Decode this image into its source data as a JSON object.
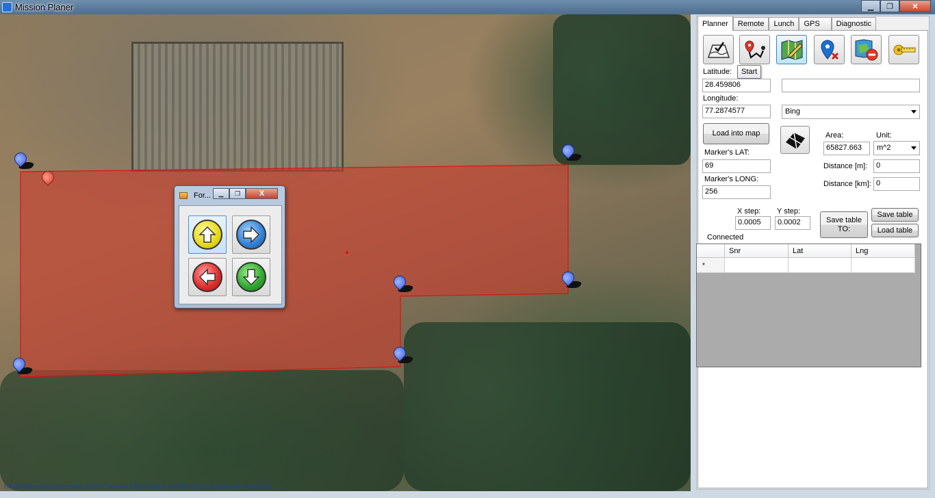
{
  "window": {
    "title": "Mission Planer",
    "controls": {
      "minimize": "▁",
      "maximize": "❐",
      "close": "✕"
    }
  },
  "map": {
    "attribution": "©2024 Microsoft Corporation  ©2024 TomTom  ©2024 Maxar  ©CNES (2024) Distribution Airbus DS"
  },
  "float_form": {
    "title": "For...",
    "controls": {
      "minimize": "▁",
      "maximize": "❐",
      "close": "X"
    },
    "buttons": [
      {
        "name": "up",
        "color": "yellow"
      },
      {
        "name": "right",
        "color": "blue"
      },
      {
        "name": "left",
        "color": "red"
      },
      {
        "name": "down",
        "color": "green"
      }
    ]
  },
  "panel": {
    "tabs": [
      "Planner",
      "Remote",
      "Lunch",
      "GPS",
      "Diagnostic"
    ],
    "active_tab": "Planner",
    "tooltip": "Start",
    "latitude_label": "Latitude:",
    "latitude_value": "28.459806",
    "extra_field_value": "",
    "longitude_label": "Longitude:",
    "longitude_value": "77.2874577",
    "map_provider": "Bing",
    "load_into_map": "Load into map",
    "area_label": "Area:",
    "area_value": "65827.663",
    "unit_label": "Unit:",
    "unit_value": "m^2",
    "marker_lat_label": "Marker's LAT:",
    "marker_lat_value": "69",
    "marker_long_label": "Marker's LONG:",
    "marker_long_value": "256",
    "distance_m_label": "Distance [m]:",
    "distance_m_value": "0",
    "distance_km_label": "Distance [km]:",
    "distance_km_value": "0",
    "x_step_label": "X step:",
    "x_step_value": "0.0005",
    "y_step_label": "Y step:",
    "y_step_value": "0.0002",
    "save_table_to": "Save table TO:",
    "save_table": "Save table",
    "load_table": "Load table",
    "status": "Connected",
    "grid": {
      "columns": [
        "Snr",
        "Lat",
        "Lng"
      ],
      "new_row_marker": "*"
    }
  }
}
